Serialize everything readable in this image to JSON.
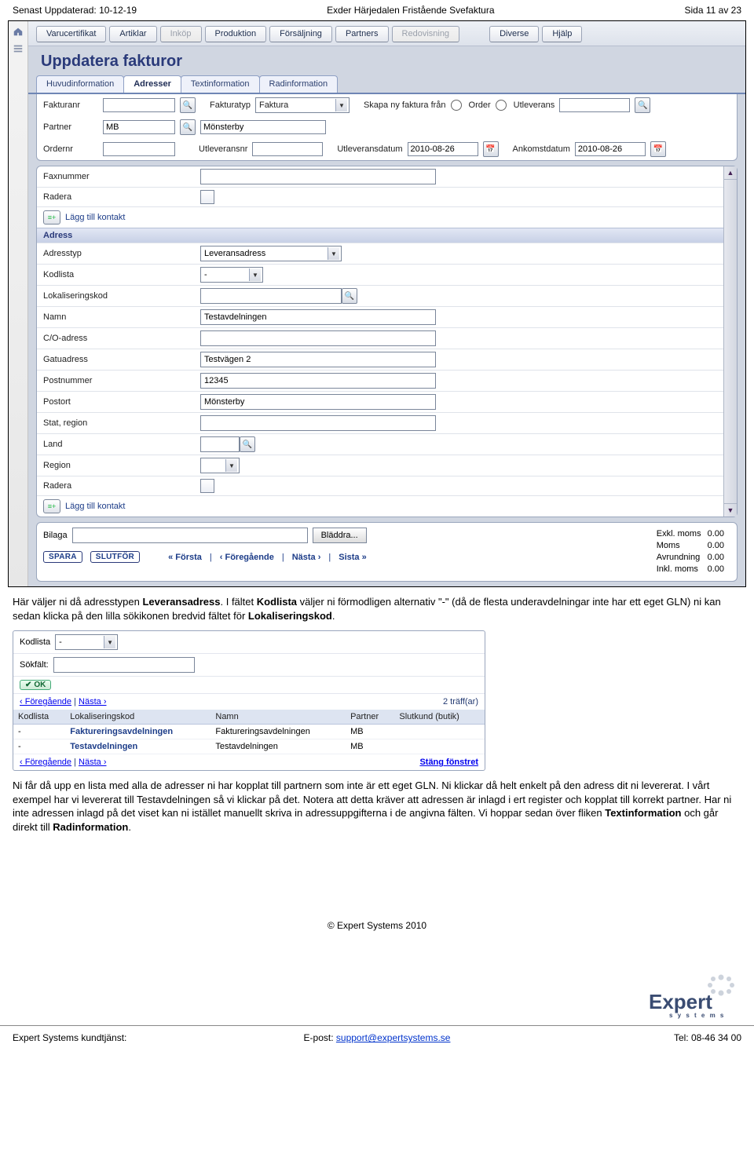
{
  "header": {
    "left": "Senast Uppdaterad: 10-12-19",
    "center": "Exder Härjedalen Fristående Svefaktura",
    "right": "Sida 11 av 23"
  },
  "menubar": {
    "items": [
      "Varucertifikat",
      "Artiklar",
      "Inköp",
      "Produktion",
      "Försäljning",
      "Partners",
      "Redovisning",
      "Diverse",
      "Hjälp"
    ],
    "dim": [
      2,
      6
    ]
  },
  "page_title": "Uppdatera fakturor",
  "subtabs": {
    "items": [
      "Huvudinformation",
      "Adresser",
      "Textinformation",
      "Radinformation"
    ],
    "active": 1
  },
  "toprow": {
    "fakturanr_label": "Fakturanr",
    "fakturanr": "",
    "fakturatyp_label": "Fakturatyp",
    "fakturatyp": "Faktura",
    "skapa_label": "Skapa ny faktura från",
    "opt_order": "Order",
    "opt_utlev": "Utleverans",
    "skapa_value": "",
    "partner_label": "Partner",
    "partner": "MB",
    "partner_name": "Mönsterby",
    "ordernr_label": "Ordernr",
    "ordernr": "",
    "utlevnr_label": "Utleveransnr",
    "utlevnr": "",
    "utlevdat_label": "Utleveransdatum",
    "utlevdat": "2010-08-26",
    "ankomst_label": "Ankomstdatum",
    "ankomst": "2010-08-26"
  },
  "scroll": {
    "fax_label": "Faxnummer",
    "fax": "",
    "radera_label": "Radera",
    "add_contact": "Lägg till kontakt",
    "section_adress": "Adress",
    "adresstyp_label": "Adresstyp",
    "adresstyp": "Leveransadress",
    "kodlista_label": "Kodlista",
    "kodlista": "-",
    "lokkod_label": "Lokaliseringskod",
    "lokkod": "",
    "namn_label": "Namn",
    "namn": "Testavdelningen",
    "co_label": "C/O-adress",
    "co": "",
    "gatu_label": "Gatuadress",
    "gatu": "Testvägen 2",
    "postnr_label": "Postnummer",
    "postnr": "12345",
    "postort_label": "Postort",
    "postort": "Mönsterby",
    "stat_label": "Stat, region",
    "stat": "",
    "land_label": "Land",
    "land": "",
    "region_label": "Region",
    "region": "",
    "radera2_label": "Radera"
  },
  "bottom": {
    "bilaga_label": "Bilaga",
    "bilaga": "",
    "browse": "Bläddra...",
    "totals": {
      "exkl": "Exkl. moms",
      "exkl_v": "0.00",
      "moms": "Moms",
      "moms_v": "0.00",
      "avr": "Avrundning",
      "avr_v": "0.00",
      "inkl": "Inkl. moms",
      "inkl_v": "0.00"
    },
    "spara": "SPARA",
    "slutfor": "SLUTFÖR",
    "nav_first": "« Första",
    "nav_prev": "‹ Föregående",
    "nav_next": "Nästa ›",
    "nav_last": "Sista »",
    "sep": " | "
  },
  "para1_a": "Här väljer ni då adresstypen ",
  "para1_b": "Leveransadress",
  "para1_c": ". I fältet ",
  "para1_d": "Kodlista",
  "para1_e": " väljer ni förmodligen alternativ \"-\" (då de flesta underavdelningar inte har ett eget GLN) ni kan sedan klicka på den lilla sökikonen bredvid fältet för ",
  "para1_f": "Lokaliseringskod",
  "para1_g": ".",
  "lookup": {
    "kodlista_label": "Kodlista",
    "kodlista": "-",
    "sokfalt_label": "Sökfält:",
    "sokfalt": "",
    "ok": "OK",
    "prev": "‹ Föregående",
    "next": "Nästa ›",
    "hits": "2 träff(ar)",
    "cols": [
      "Kodlista",
      "Lokaliseringskod",
      "Namn",
      "Partner",
      "Slutkund (butik)"
    ],
    "rows": [
      {
        "kod": "-",
        "lok": "Faktureringsavdelningen",
        "namn": "Faktureringsavdelningen",
        "partner": "MB",
        "slut": ""
      },
      {
        "kod": "-",
        "lok": "Testavdelningen",
        "namn": "Testavdelningen",
        "partner": "MB",
        "slut": ""
      }
    ],
    "close": "Stäng fönstret"
  },
  "para2_a": "Ni får då upp en lista med alla de adresser ni har kopplat till partnern som inte är ett eget GLN. Ni klickar då helt enkelt på den adress dit ni levererat. I vårt exempel har vi levererat till Testavdelningen så vi klickar på det. Notera att detta kräver att adressen är inlagd i ert register och kopplat till korrekt partner. Har ni inte adressen inlagd på det viset kan ni istället manuellt skriva in adressuppgifterna i de angivna fälten. Vi hoppar sedan över fliken ",
  "para2_b": "Textinformation",
  "para2_c": " och går direkt till ",
  "para2_d": "Radinformation",
  "para2_e": ".",
  "footer": {
    "copy": "© Expert Systems 2010",
    "left": "Expert Systems kundtjänst:",
    "center_pre": "E-post: ",
    "center_link": "support@expertsystems.se",
    "right": "Tel: 08-46 34 00",
    "logo_text": "Expert",
    "logo_sub": "s y s t e m s"
  }
}
